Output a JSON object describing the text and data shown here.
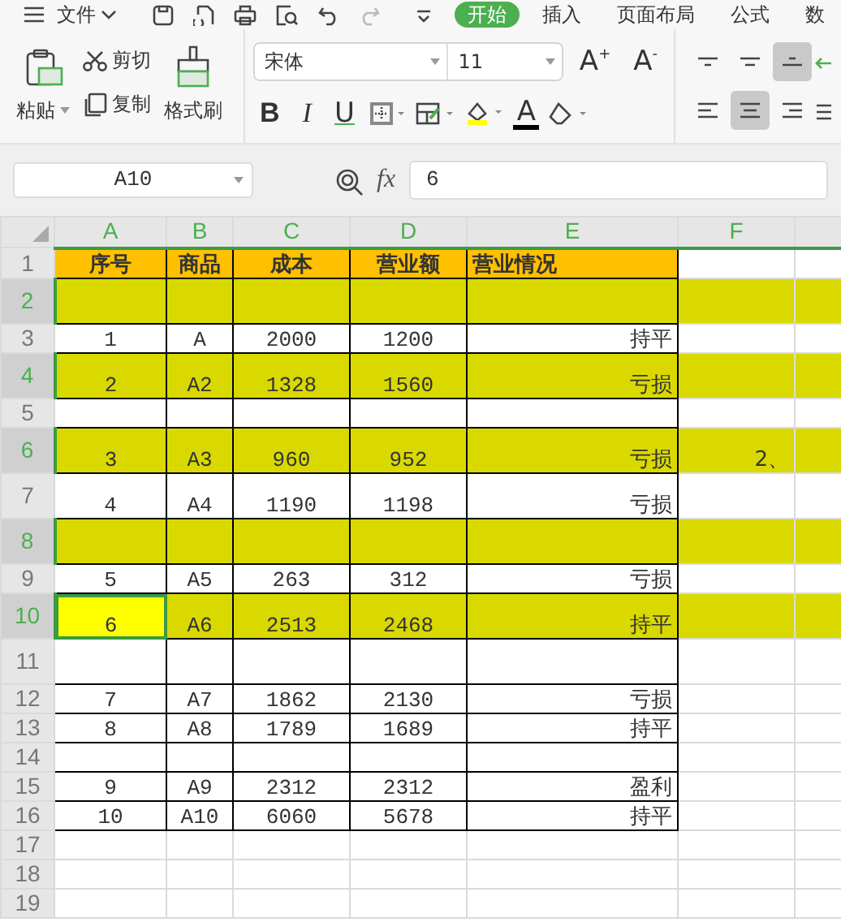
{
  "menu": {
    "file_label": "文件"
  },
  "tabs": [
    {
      "label": "开始",
      "selected": true
    },
    {
      "label": "插入",
      "selected": false
    },
    {
      "label": "页面布局",
      "selected": false
    },
    {
      "label": "公式",
      "selected": false
    },
    {
      "label": "数",
      "selected": false
    }
  ],
  "ribbon": {
    "paste": "粘贴",
    "cut": "剪切",
    "copy": "复制",
    "format_painter": "格式刷",
    "font": "宋体",
    "font_size": "11",
    "grow": "A$^{+}$",
    "shrink": "A$^{-}$",
    "bold": "B",
    "italic": "I",
    "underline": "U",
    "font_color": "A"
  },
  "formula_bar": {
    "cell_ref": "A10",
    "fx": "fx",
    "value": "6"
  },
  "columns": [
    "A",
    "B",
    "C",
    "D",
    "E",
    "F"
  ],
  "rows": [
    {
      "num": "1",
      "kind": "header",
      "selected": false,
      "highlight": false,
      "tall": false,
      "cells": [
        "序号",
        "商品",
        "成本",
        "营业额",
        "营业情况",
        null,
        null
      ]
    },
    {
      "num": "2",
      "kind": "data",
      "selected": true,
      "highlight": true,
      "tall": true,
      "cells": [
        null,
        null,
        null,
        null,
        null,
        null,
        null
      ]
    },
    {
      "num": "3",
      "kind": "data",
      "selected": false,
      "highlight": false,
      "tall": false,
      "cells": [
        "1",
        "A",
        "2000",
        "1200",
        "持平",
        null,
        null
      ]
    },
    {
      "num": "4",
      "kind": "data",
      "selected": true,
      "highlight": true,
      "tall": true,
      "cells": [
        "2",
        "A2",
        "1328",
        "1560",
        "亏损",
        null,
        null
      ]
    },
    {
      "num": "5",
      "kind": "data",
      "selected": false,
      "highlight": false,
      "tall": false,
      "cells": [
        null,
        null,
        null,
        null,
        null,
        null,
        null
      ]
    },
    {
      "num": "6",
      "kind": "data",
      "selected": true,
      "highlight": true,
      "tall": true,
      "cells": [
        "3",
        "A3",
        "960",
        "952",
        "亏损",
        "2、",
        null
      ]
    },
    {
      "num": "7",
      "kind": "data",
      "selected": false,
      "highlight": false,
      "tall": true,
      "cells": [
        "4",
        "A4",
        "1190",
        "1198",
        "亏损",
        null,
        null
      ]
    },
    {
      "num": "8",
      "kind": "data",
      "selected": true,
      "highlight": true,
      "tall": true,
      "cells": [
        null,
        null,
        null,
        null,
        null,
        null,
        null
      ]
    },
    {
      "num": "9",
      "kind": "data",
      "selected": false,
      "highlight": false,
      "tall": false,
      "cells": [
        "5",
        "A5",
        "263",
        "312",
        "亏损",
        null,
        null
      ]
    },
    {
      "num": "10",
      "kind": "data",
      "selected": true,
      "highlight": true,
      "tall": true,
      "active": true,
      "cells": [
        "6",
        "A6",
        "2513",
        "2468",
        "持平",
        null,
        null
      ]
    },
    {
      "num": "11",
      "kind": "data",
      "selected": false,
      "highlight": false,
      "tall": true,
      "cells": [
        null,
        null,
        null,
        null,
        null,
        null,
        null
      ]
    },
    {
      "num": "12",
      "kind": "data",
      "selected": false,
      "highlight": false,
      "tall": false,
      "cells": [
        "7",
        "A7",
        "1862",
        "2130",
        "亏损",
        null,
        null
      ]
    },
    {
      "num": "13",
      "kind": "data",
      "selected": false,
      "highlight": false,
      "tall": false,
      "cells": [
        "8",
        "A8",
        "1789",
        "1689",
        "持平",
        null,
        null
      ]
    },
    {
      "num": "14",
      "kind": "data",
      "selected": false,
      "highlight": false,
      "tall": false,
      "cells": [
        null,
        null,
        null,
        null,
        null,
        null,
        null
      ]
    },
    {
      "num": "15",
      "kind": "data",
      "selected": false,
      "highlight": false,
      "tall": false,
      "cells": [
        "9",
        "A9",
        "2312",
        "2312",
        "盈利",
        null,
        null
      ]
    },
    {
      "num": "16",
      "kind": "data",
      "selected": false,
      "highlight": false,
      "tall": false,
      "cells": [
        "10",
        "A10",
        "6060",
        "5678",
        "持平",
        null,
        null
      ]
    },
    {
      "num": "17",
      "kind": "blank",
      "selected": false,
      "highlight": false,
      "tall": false,
      "cells": [
        null,
        null,
        null,
        null,
        null,
        null,
        null
      ]
    },
    {
      "num": "18",
      "kind": "blank",
      "selected": false,
      "highlight": false,
      "tall": false,
      "cells": [
        null,
        null,
        null,
        null,
        null,
        null,
        null
      ]
    },
    {
      "num": "19",
      "kind": "blank",
      "selected": false,
      "highlight": false,
      "tall": false,
      "cells": [
        null,
        null,
        null,
        null,
        null,
        null,
        null
      ]
    }
  ]
}
